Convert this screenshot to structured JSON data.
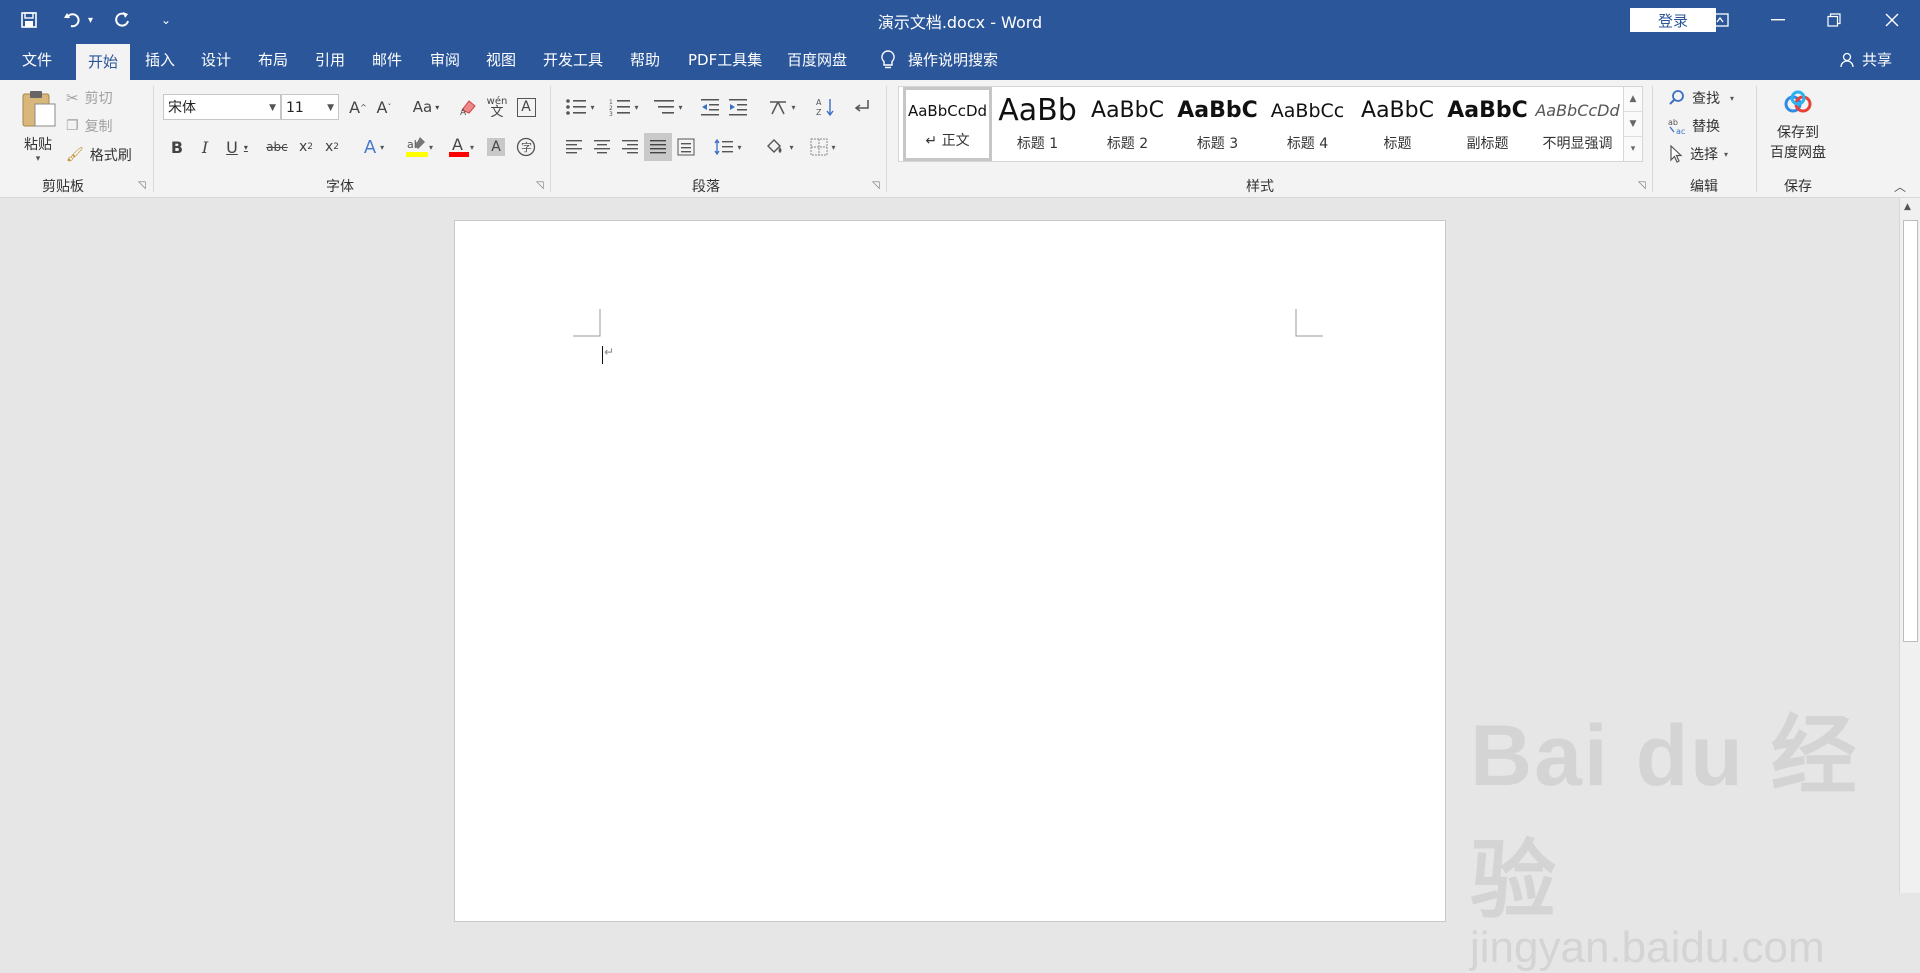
{
  "window": {
    "title": "演示文档.docx  -  Word",
    "login": "登录",
    "controls": {
      "ribbon_display": "⊡",
      "minimize": "—",
      "restore": "❐",
      "close": "✕"
    }
  },
  "qat": {
    "save": "💾",
    "undo": "↶",
    "redo": "↻",
    "customize": "⌄"
  },
  "menu": {
    "items": [
      "文件",
      "开始",
      "插入",
      "设计",
      "布局",
      "引用",
      "邮件",
      "审阅",
      "视图",
      "开发工具",
      "帮助",
      "PDF工具集",
      "百度网盘"
    ],
    "active": "开始",
    "tellme": "操作说明搜索",
    "share": "共享"
  },
  "clipboard": {
    "paste": "粘贴",
    "cut": "剪切",
    "copy": "复制",
    "format_painter": "格式刷",
    "label": "剪贴板"
  },
  "font": {
    "name": "宋体",
    "size": "11",
    "label": "字体",
    "bold": "B",
    "italic": "I",
    "underline": "U",
    "strike": "abc",
    "sub": "x₂",
    "sup": "x²",
    "grow": "A^",
    "shrink": "Aˇ",
    "case": "Aa",
    "phonetic": "wén 文",
    "border": "A",
    "highlight_color": "#ffff00",
    "font_color": "#ff0000"
  },
  "paragraph": {
    "label": "段落"
  },
  "styles": {
    "label": "样式",
    "items": [
      {
        "sample": "AaBbCcDd",
        "name": "↵ 正文"
      },
      {
        "sample": "AaBb",
        "name": "标题 1"
      },
      {
        "sample": "AaBbC",
        "name": "标题 2"
      },
      {
        "sample": "AaBbC",
        "name": "标题 3"
      },
      {
        "sample": "AaBbCc",
        "name": "标题 4"
      },
      {
        "sample": "AaBbC",
        "name": "标题"
      },
      {
        "sample": "AaBbC",
        "name": "副标题"
      },
      {
        "sample": "AaBbCcDd",
        "name": "不明显强调"
      }
    ]
  },
  "editing": {
    "find": "查找",
    "replace": "替换",
    "select": "选择",
    "label": "编辑"
  },
  "save_group": {
    "save_to_1": "保存到",
    "save_to_2": "百度网盘",
    "label": "保存"
  },
  "watermark": {
    "main": "Bai du 经验",
    "sub": "jingyan.baidu.com"
  }
}
